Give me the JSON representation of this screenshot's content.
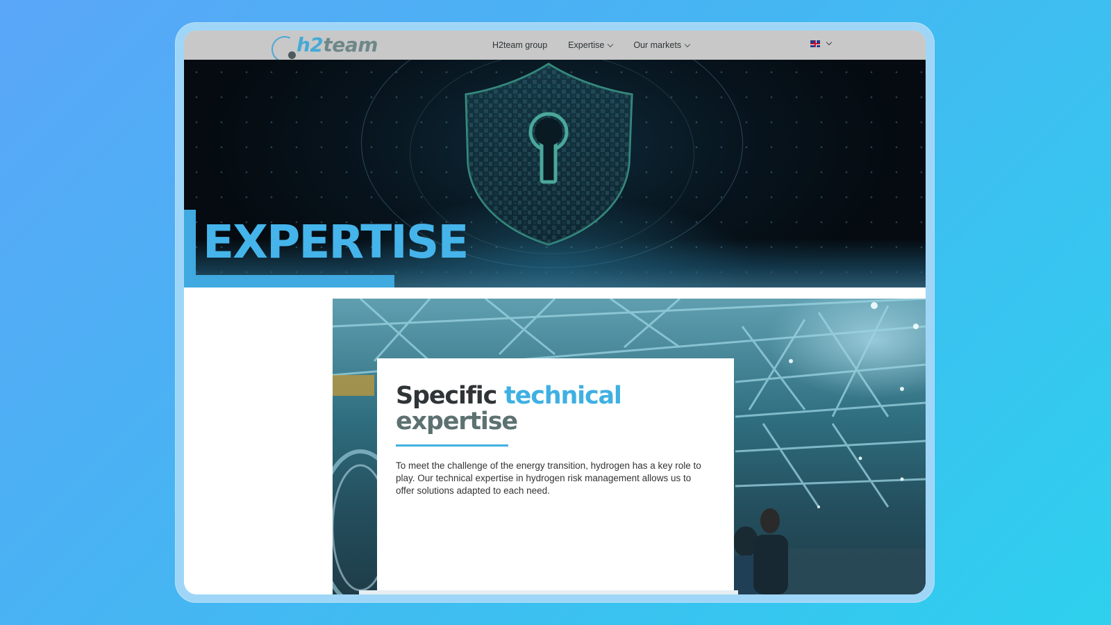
{
  "nav": {
    "logo": {
      "prefix": "h2",
      "suffix": "team"
    },
    "items": [
      {
        "label": "H2team group",
        "has_dropdown": false
      },
      {
        "label": "Expertise",
        "has_dropdown": true
      },
      {
        "label": "Our markets",
        "has_dropdown": true
      }
    ],
    "language": {
      "icon": "uk-flag-icon",
      "dropdown_icon": "chevron-down-icon"
    }
  },
  "hero": {
    "title": "EXPERTISE",
    "accent_color": "#3fa9e0",
    "image_icon": "shield-keyhole"
  },
  "content": {
    "heading_part1": "Specific",
    "heading_part2": "technical",
    "heading_part3": "expertise",
    "body": "To meet the challenge of the energy transition, hydrogen has a key role to play. Our technical expertise in hydrogen risk management allows us to offer solutions adapted to each need.",
    "heading_accent_color": "#3fb0e2"
  }
}
